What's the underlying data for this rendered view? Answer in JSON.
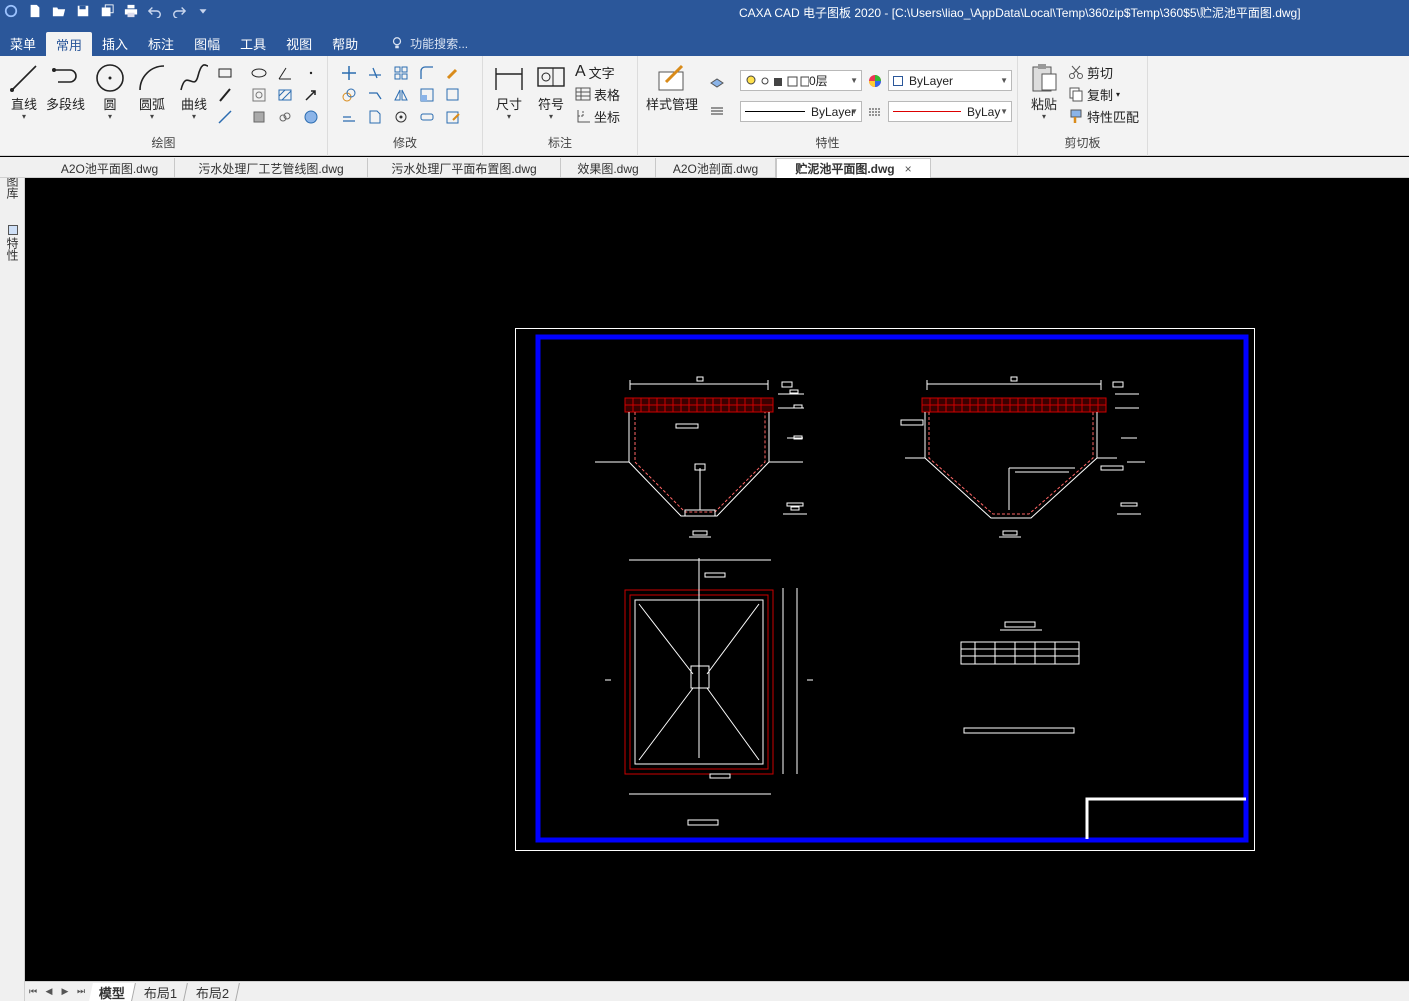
{
  "title": "CAXA CAD 电子图板 2020 - [C:\\Users\\liao_\\AppData\\Local\\Temp\\360zip$Temp\\360$5\\贮泥池平面图.dwg]",
  "menu": {
    "items": [
      "菜单",
      "常用",
      "插入",
      "标注",
      "图幅",
      "工具",
      "视图",
      "帮助"
    ],
    "active": "常用",
    "search": "功能搜索..."
  },
  "ribbon": {
    "draw": {
      "label": "绘图",
      "line": "直线",
      "polyline": "多段线",
      "circle": "圆",
      "arc": "圆弧",
      "curve": "曲线"
    },
    "modify": {
      "label": "修改"
    },
    "annotate": {
      "label": "标注",
      "dimension": "尺寸",
      "symbol": "符号",
      "text": "文字",
      "table": "表格",
      "coordinate": "坐标"
    },
    "properties": {
      "label": "特性",
      "style_manager": "样式管理",
      "layer": "0层",
      "color": "ByLayer",
      "linetype": "ByLayer",
      "lineweight": "ByLay"
    },
    "clipboard": {
      "label": "剪切板",
      "paste": "粘贴",
      "cut": "剪切",
      "copy": "复制",
      "match": "特性匹配"
    }
  },
  "doc_tabs": [
    "A2O池平面图.dwg",
    "污水处理厂工艺管线图.dwg",
    "污水处理厂平面布置图.dwg",
    "效果图.dwg",
    "A2O池剖面.dwg",
    "贮泥池平面图.dwg"
  ],
  "active_doc": "贮泥池平面图.dwg",
  "left_panel": [
    "图库",
    "特性"
  ],
  "layout_tabs": [
    "模型",
    "布局1",
    "布局2"
  ],
  "colors": {
    "title_bg": "#2b579a",
    "ribbon_bg": "#f3f3f3",
    "canvas_bg": "#000000",
    "frame_blue": "#0000ff",
    "section_red": "#cc0000"
  }
}
